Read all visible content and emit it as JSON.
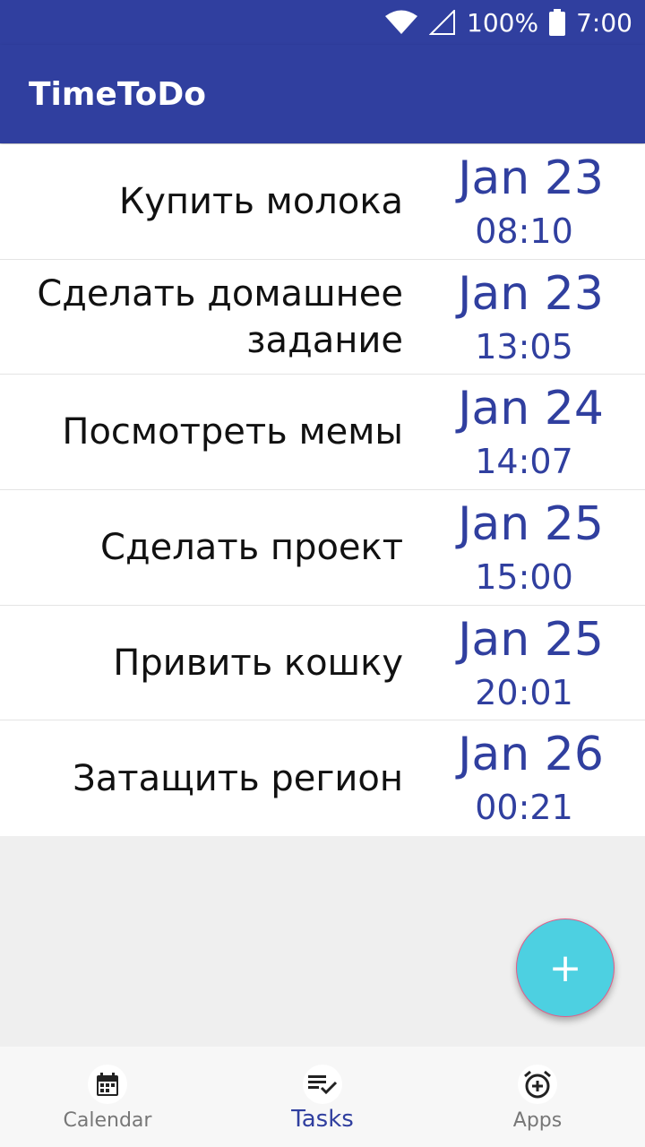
{
  "status_bar": {
    "battery": "100%",
    "time": "7:00"
  },
  "app_bar": {
    "title": "TimeToDo"
  },
  "tasks": [
    {
      "title": "Купить молока",
      "date": "Jan 23",
      "time": "08:10"
    },
    {
      "title": "Сделать домашнее задание",
      "date": "Jan 23",
      "time": "13:05"
    },
    {
      "title": "Посмотреть мемы",
      "date": "Jan 24",
      "time": "14:07"
    },
    {
      "title": "Сделать проект",
      "date": "Jan 25",
      "time": "15:00"
    },
    {
      "title": "Привить кошку",
      "date": "Jan 25",
      "time": "20:01"
    },
    {
      "title": "Затащить регион",
      "date": "Jan 26",
      "time": "00:21"
    }
  ],
  "fab": {
    "icon": "plus-icon",
    "symbol": "+"
  },
  "bottom_nav": {
    "items": [
      {
        "label": "Calendar",
        "icon": "calendar-icon"
      },
      {
        "label": "Tasks",
        "icon": "tasks-icon"
      },
      {
        "label": "Apps",
        "icon": "alarm-add-icon"
      }
    ],
    "active": "Tasks"
  },
  "colors": {
    "primary": "#303f9f",
    "fab": "#4dd0e1",
    "background": "#efefef"
  }
}
